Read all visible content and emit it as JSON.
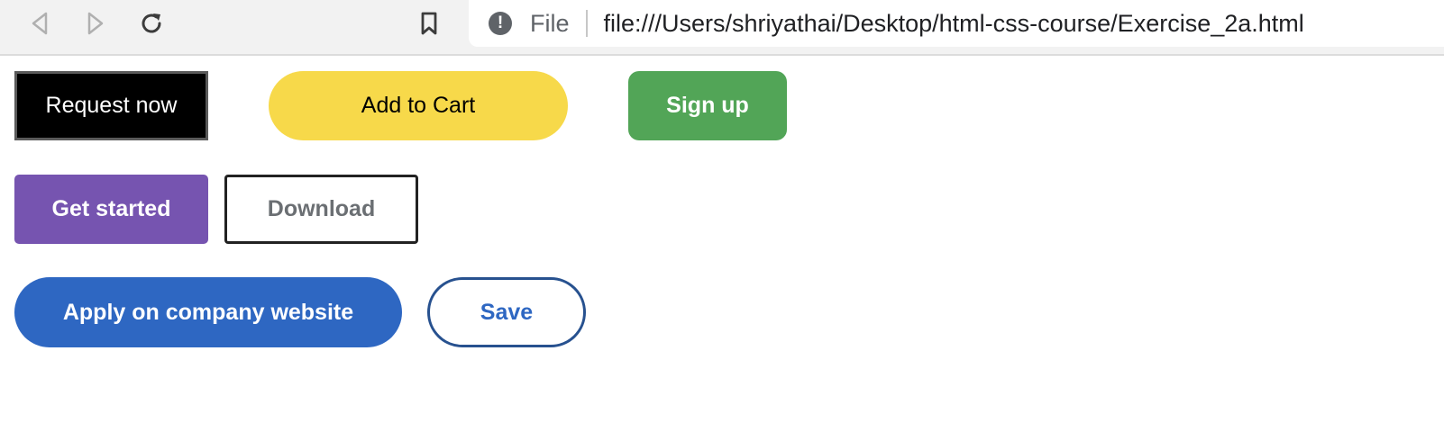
{
  "browser": {
    "icons": {
      "back": "back-arrow-icon",
      "forward": "forward-arrow-icon",
      "reload": "reload-icon",
      "bookmark": "bookmark-icon",
      "site_info": "info-icon"
    },
    "site_info_glyph": "!",
    "scheme_label": "File",
    "url": "file:///Users/shriyathai/Desktop/html-css-course/Exercise_2a.html"
  },
  "buttons": {
    "request_now": "Request now",
    "add_to_cart": "Add to Cart",
    "sign_up": "Sign up",
    "get_started": "Get started",
    "download": "Download",
    "apply": "Apply on company website",
    "save": "Save"
  },
  "colors": {
    "yellow": "#f7d94a",
    "green": "#52a557",
    "purple": "#7654b0",
    "blue": "#2e67c2",
    "black": "#000000"
  }
}
